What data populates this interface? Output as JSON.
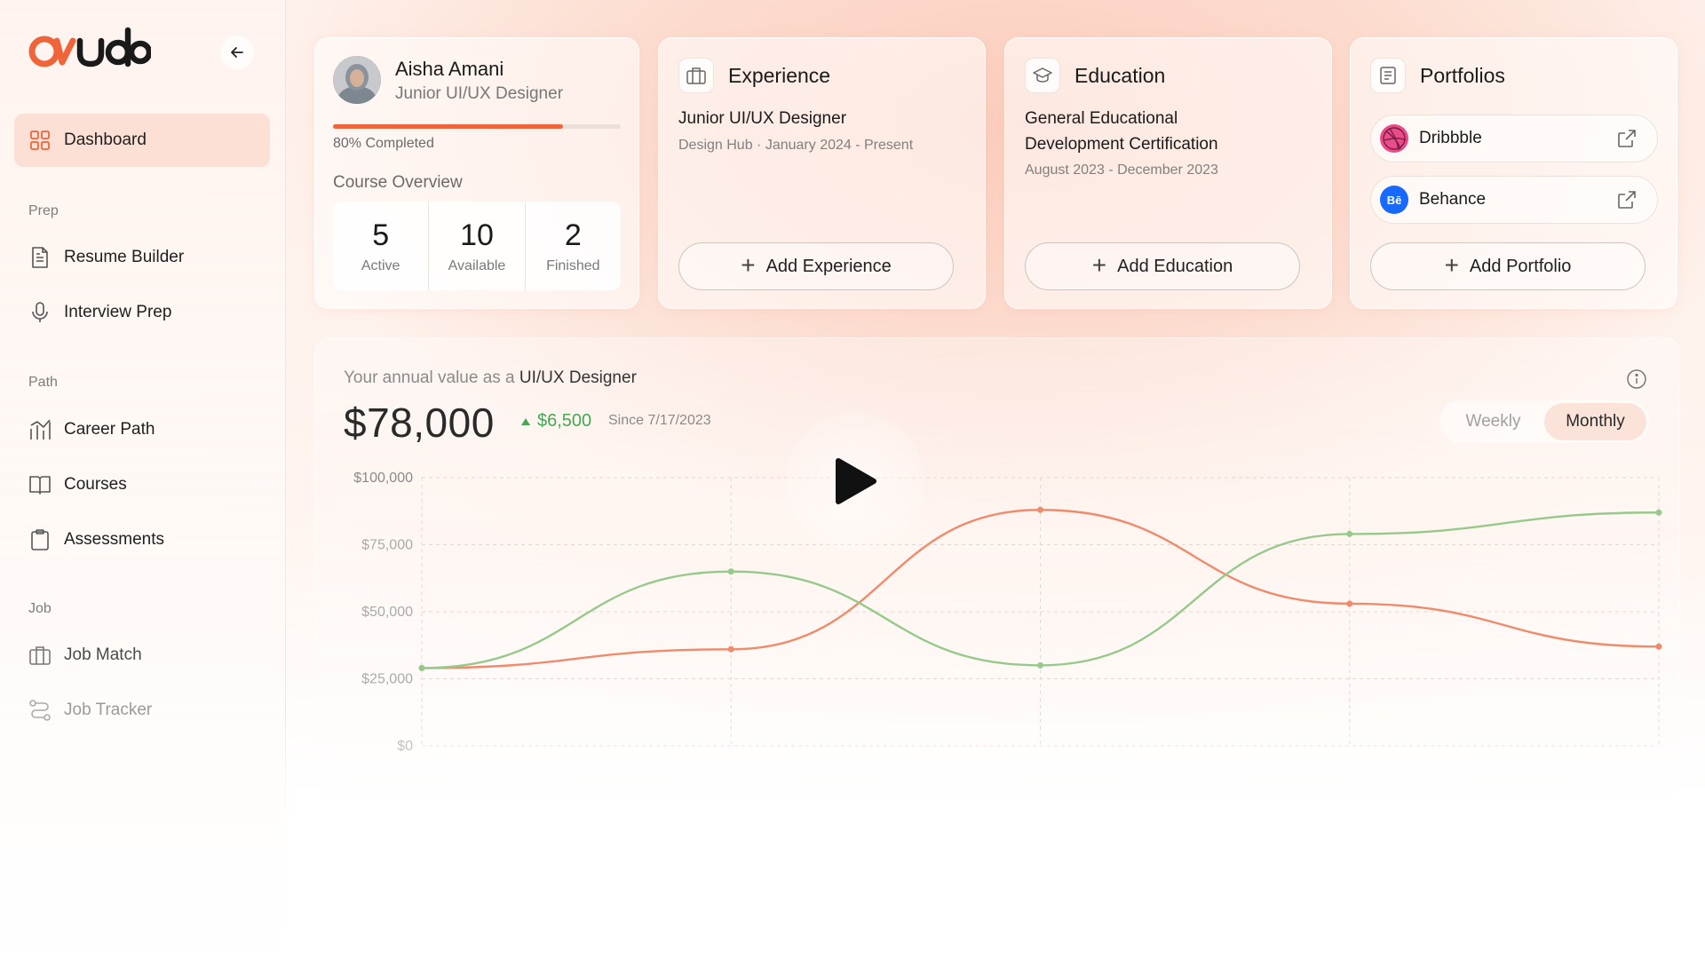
{
  "app": {
    "logo_text": "oudo"
  },
  "sidebar": {
    "dashboard": "Dashboard",
    "sections": {
      "prep": "Prep",
      "path": "Path",
      "job": "Job"
    },
    "items": {
      "resume_builder": "Resume Builder",
      "interview_prep": "Interview Prep",
      "career_path": "Career Path",
      "courses": "Courses",
      "assessments": "Assessments",
      "job_match": "Job Match",
      "job_tracker": "Job Tracker"
    }
  },
  "profile": {
    "name": "Aisha Amani",
    "role": "Junior UI/UX Designer",
    "progress_percent": 80,
    "progress_text": "80% Completed",
    "course_overview_label": "Course Overview",
    "stats": [
      {
        "value": "5",
        "label": "Active"
      },
      {
        "value": "10",
        "label": "Available"
      },
      {
        "value": "2",
        "label": "Finished"
      }
    ]
  },
  "experience": {
    "title": "Experience",
    "entry_title": "Junior UI/UX Designer",
    "entry_sub": "Design Hub · January 2024 - Present",
    "add_label": "Add Experience"
  },
  "education": {
    "title": "Education",
    "entry_title_line1": "General Educational",
    "entry_title_line2": "Development Certification",
    "entry_sub": "August 2023 - December 2023",
    "add_label": "Add Education"
  },
  "portfolios": {
    "title": "Portfolios",
    "links": [
      {
        "name": "Dribbble",
        "color": "#ea4c89"
      },
      {
        "name": "Behance",
        "color": "#1769ff",
        "glyph": "Bē"
      }
    ],
    "add_label": "Add Portfolio"
  },
  "annual_value": {
    "caption_prefix": "Your annual value as a",
    "caption_role": "UI/UX Designer",
    "value": "$78,000",
    "delta": "$6,500",
    "since": "Since 7/17/2023",
    "toggle": {
      "weekly": "Weekly",
      "monthly": "Monthly",
      "selected": "Monthly"
    }
  },
  "chart_data": {
    "type": "line",
    "title": "",
    "xlabel": "",
    "ylabel": "",
    "y_ticks": [
      "$100,000",
      "$75,000",
      "$50,000",
      "$25,000",
      "$0"
    ],
    "ylim": [
      0,
      100000
    ],
    "x": [
      0,
      1,
      2,
      3,
      4
    ],
    "series": [
      {
        "color": "#f08a6a",
        "values": [
          29000,
          36000,
          88000,
          53000,
          37000
        ]
      },
      {
        "color": "#96c98a",
        "values": [
          29000,
          65000,
          30000,
          79000,
          87000
        ]
      }
    ],
    "grid": true,
    "colors": {
      "accent": "#f0643a",
      "positive": "#46a757"
    }
  }
}
